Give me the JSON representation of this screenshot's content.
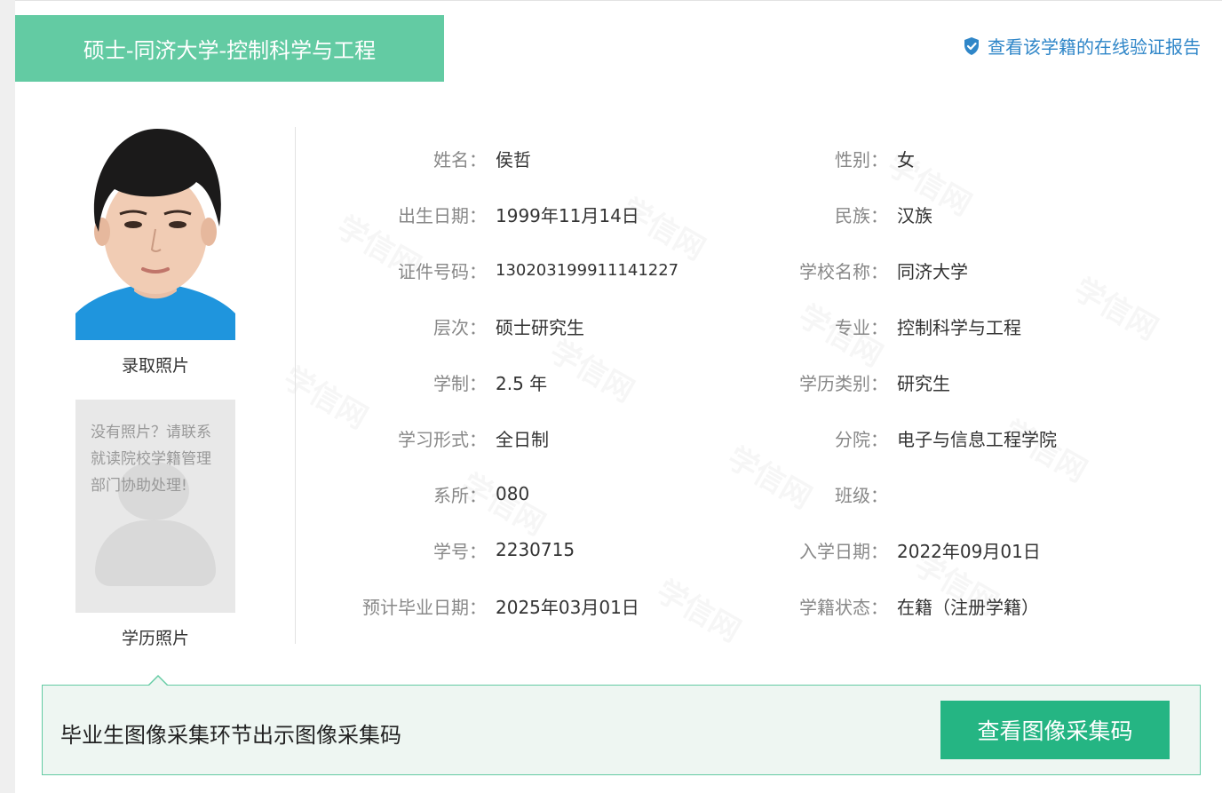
{
  "header": {
    "title": "硕士-同济大学-控制科学与工程",
    "verify_link": "查看该学籍的在线验证报告"
  },
  "photos": {
    "admission_caption": "录取照片",
    "degree_caption": "学历照片",
    "placeholder_text": "没有照片？请联系就读院校学籍管理部门协助处理!"
  },
  "fields_left": [
    {
      "label": "姓名：",
      "value": "侯哲"
    },
    {
      "label": "出生日期：",
      "value": "1999年11月14日"
    },
    {
      "label": "证件号码：",
      "value": "130203199911141227"
    },
    {
      "label": "层次：",
      "value": "硕士研究生"
    },
    {
      "label": "学制：",
      "value": "2.5 年"
    },
    {
      "label": "学习形式：",
      "value": "全日制"
    },
    {
      "label": "系所：",
      "value": "080"
    },
    {
      "label": "学号：",
      "value": "2230715"
    },
    {
      "label": "预计毕业日期：",
      "value": "2025年03月01日"
    }
  ],
  "fields_right": [
    {
      "label": "性别：",
      "value": "女"
    },
    {
      "label": "民族：",
      "value": "汉族"
    },
    {
      "label": "学校名称：",
      "value": "同济大学"
    },
    {
      "label": "专业：",
      "value": "控制科学与工程"
    },
    {
      "label": "学历类别：",
      "value": "研究生"
    },
    {
      "label": "分院：",
      "value": "电子与信息工程学院"
    },
    {
      "label": "班级：",
      "value": ""
    },
    {
      "label": "入学日期：",
      "value": "2022年09月01日"
    },
    {
      "label": "学籍状态：",
      "value": "在籍（注册学籍）"
    }
  ],
  "bottom": {
    "notice": "毕业生图像采集环节出示图像采集码",
    "button": "查看图像采集码"
  },
  "watermark_text": "学信网",
  "colors": {
    "accent_green": "#63cba3",
    "button_green": "#25b583",
    "link_blue": "#2f86c8"
  }
}
